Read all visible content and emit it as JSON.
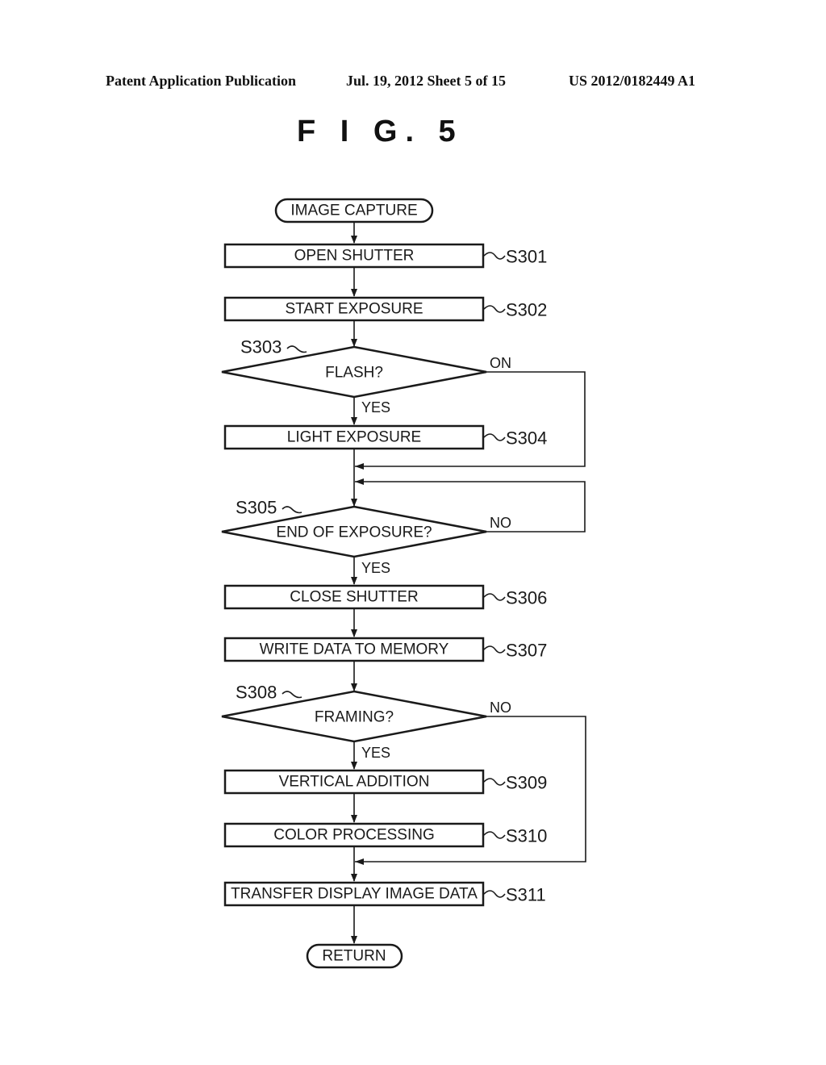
{
  "header": {
    "left": "Patent Application Publication",
    "middle": "Jul. 19, 2012   Sheet 5 of 15",
    "right": "US 2012/0182449 A1"
  },
  "figure": {
    "title": "F I G. 5"
  },
  "flowchart": {
    "start": "IMAGE CAPTURE",
    "end": "RETURN",
    "steps": [
      {
        "id": "S301",
        "type": "process",
        "text": "OPEN SHUTTER"
      },
      {
        "id": "S302",
        "type": "process",
        "text": "START EXPOSURE"
      },
      {
        "id": "S303",
        "type": "decision",
        "text": "FLASH?"
      },
      {
        "id": "S304",
        "type": "process",
        "text": "LIGHT EXPOSURE"
      },
      {
        "id": "S305",
        "type": "decision",
        "text": "END OF EXPOSURE?"
      },
      {
        "id": "S306",
        "type": "process",
        "text": "CLOSE SHUTTER"
      },
      {
        "id": "S307",
        "type": "process",
        "text": "WRITE DATA TO MEMORY"
      },
      {
        "id": "S308",
        "type": "decision",
        "text": "FRAMING?"
      },
      {
        "id": "S309",
        "type": "process",
        "text": "VERTICAL ADDITION"
      },
      {
        "id": "S310",
        "type": "process",
        "text": "COLOR PROCESSING"
      },
      {
        "id": "S311",
        "type": "process",
        "text": "TRANSFER DISPLAY IMAGE DATA"
      }
    ],
    "branches": {
      "s303_yes": "YES",
      "s303_other": "ON",
      "s305_yes": "YES",
      "s305_no": "NO",
      "s308_yes": "YES",
      "s308_no": "NO"
    }
  }
}
